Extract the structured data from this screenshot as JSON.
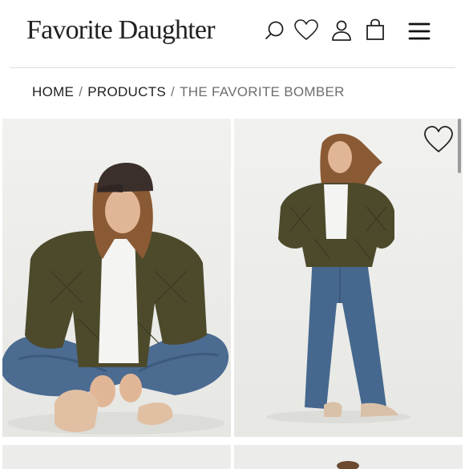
{
  "header": {
    "logo_text": "Favorite Daughter",
    "icons": [
      "search-icon",
      "heart-icon",
      "account-icon",
      "bag-icon",
      "menu-icon"
    ]
  },
  "breadcrumb": {
    "home": "HOME",
    "separator": "/",
    "products": "PRODUCTS",
    "current": "THE FAVORITE BOMBER"
  },
  "gallery": {
    "images": [
      "model-seated-bomber-photo",
      "model-standing-bomber-photo",
      "product-photo-3",
      "product-photo-4"
    ],
    "wishlist_icon": "heart-icon"
  },
  "colors": {
    "jacket": "#4d4a2c",
    "denim": "#46688e",
    "background": "#eeeeec"
  }
}
